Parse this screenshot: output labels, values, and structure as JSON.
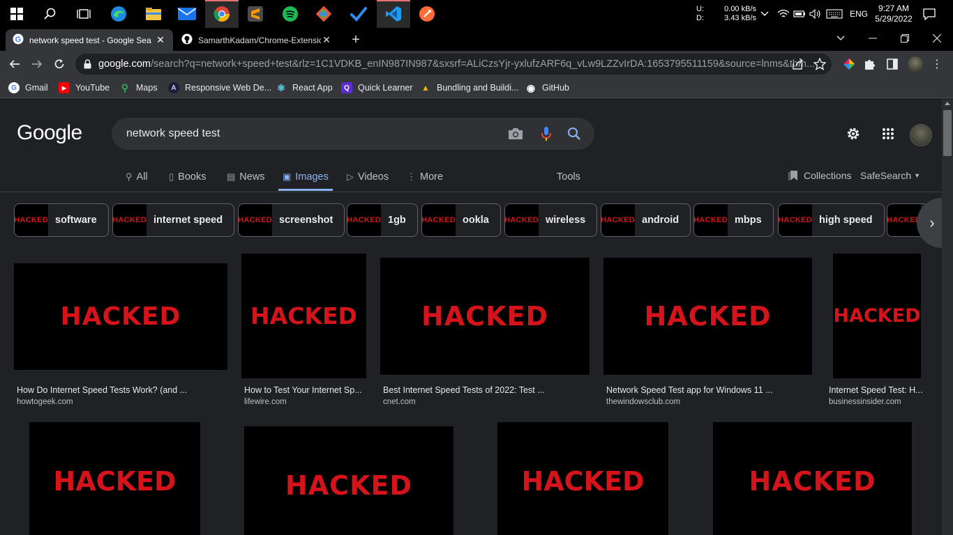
{
  "taskbar": {
    "icons": [
      "windows-start-icon",
      "search-icon",
      "task-view-icon",
      "edge-icon",
      "file-explorer-icon",
      "mail-icon",
      "chrome-icon",
      "sublime-text-icon",
      "spotify-icon",
      "git-icon",
      "todo-icon",
      "vscode-icon",
      "postman-icon"
    ],
    "net_up_label": "U:",
    "net_down_label": "D:",
    "net_up_value": "0.00 kB/s",
    "net_down_value": "3.43 kB/s",
    "language": "ENG",
    "time": "9:27 AM",
    "date": "5/29/2022"
  },
  "tabs": [
    {
      "title": "network speed test - Google Sea",
      "active": true
    },
    {
      "title": "SamarthKadam/Chrome-Extensic",
      "active": false
    }
  ],
  "omnibox": {
    "host": "google.com",
    "path": "/search?q=network+speed+test&rlz=1C1VDKB_enIN987IN987&sxsrf=ALiCzsYjr-yxlufzARF6q_vLw9LZZvIrDA:1653795511159&source=lnms&tbm..."
  },
  "bookmarks": [
    {
      "label": "Gmail",
      "icon": "G"
    },
    {
      "label": "YouTube",
      "icon": "▶"
    },
    {
      "label": "Maps",
      "icon": "⚲"
    },
    {
      "label": "Responsive Web De...",
      "icon": "A"
    },
    {
      "label": "React App",
      "icon": "⚛"
    },
    {
      "label": "Quick Learner",
      "icon": "Q"
    },
    {
      "label": "Bundling and Buildi...",
      "icon": "▲"
    },
    {
      "label": "GitHub",
      "icon": "◉"
    }
  ],
  "search": {
    "logo": "Google",
    "query": "network speed test"
  },
  "navtabs": [
    {
      "label": "All",
      "icon": "⚲"
    },
    {
      "label": "Books",
      "icon": "▯"
    },
    {
      "label": "News",
      "icon": "▤"
    },
    {
      "label": "Images",
      "icon": "▣"
    },
    {
      "label": "Videos",
      "icon": "▷"
    },
    {
      "label": "More",
      "icon": "⋮"
    }
  ],
  "tools_label": "Tools",
  "collections_label": "Collections",
  "safesearch_label": "SafeSearch",
  "chip_thumb_text": "HACKED",
  "chips": [
    "software",
    "internet speed",
    "screenshot",
    "1gb",
    "ookla",
    "wireless",
    "android",
    "mbps",
    "high speed",
    ""
  ],
  "image_text": "HACKED",
  "results_row1": [
    {
      "caption": "How Do Internet Speed Tests Work? (and ...",
      "source": "howtogeek.com"
    },
    {
      "caption": "How to Test Your Internet Sp...",
      "source": "lifewire.com"
    },
    {
      "caption": "Best Internet Speed Tests of 2022: Test ...",
      "source": "cnet.com"
    },
    {
      "caption": "Network Speed Test app for Windows 11 ...",
      "source": "thewindowsclub.com"
    },
    {
      "caption": "Internet Speed Test: H...",
      "source": "businessinsider.com"
    }
  ],
  "colors": {
    "accent": "#8ab4f8",
    "hacked_red": "#d4141a",
    "page_bg": "#202124"
  }
}
